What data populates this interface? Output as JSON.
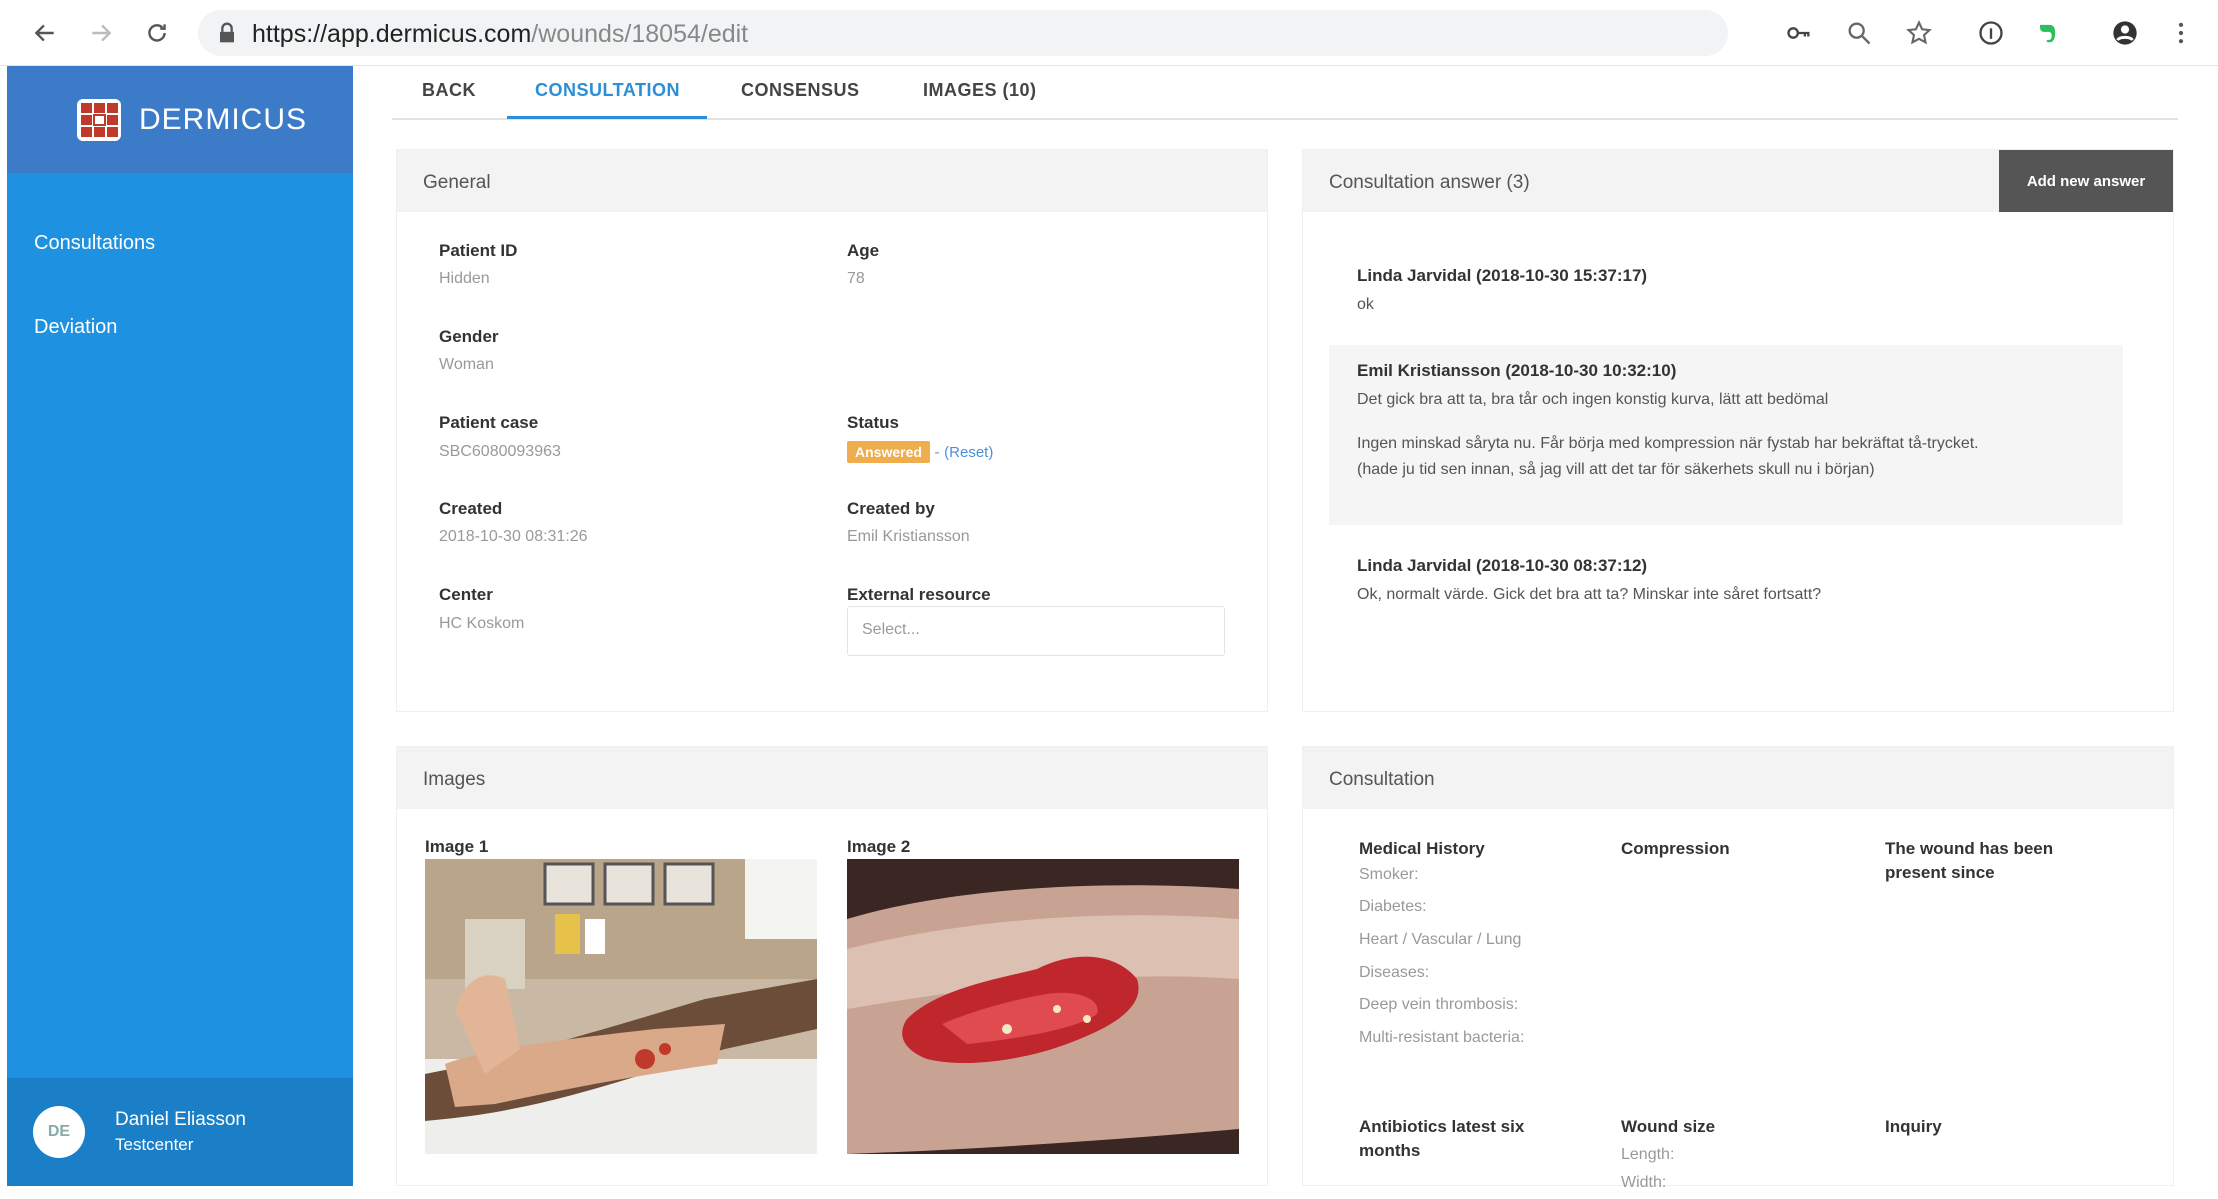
{
  "browser": {
    "url_host": "https://app.dermicus.com",
    "url_path": "/wounds/18054/edit"
  },
  "sidebar": {
    "brand": "DERMICUS",
    "items": [
      {
        "label": "Consultations"
      },
      {
        "label": "Deviation"
      }
    ],
    "user": {
      "initials": "DE",
      "name": "Daniel Eliasson",
      "role": "Testcenter"
    }
  },
  "tabs": [
    {
      "label": "BACK"
    },
    {
      "label": "CONSULTATION",
      "active": true
    },
    {
      "label": "CONSENSUS"
    },
    {
      "label": "IMAGES (10)"
    }
  ],
  "general": {
    "title": "General",
    "patient_id_label": "Patient ID",
    "patient_id": "Hidden",
    "age_label": "Age",
    "age": "78",
    "gender_label": "Gender",
    "gender": "Woman",
    "patient_case_label": "Patient case",
    "patient_case": "SBC6080093963",
    "status_label": "Status",
    "status": "Answered",
    "status_reset": "(Reset)",
    "created_label": "Created",
    "created": "2018-10-30 08:31:26",
    "created_by_label": "Created by",
    "created_by": "Emil Kristiansson",
    "center_label": "Center",
    "center": "HC Koskom",
    "external_label": "External resource",
    "external_placeholder": "Select..."
  },
  "answers": {
    "title": "Consultation answer (3)",
    "add_button": "Add new answer",
    "items": [
      {
        "author": "Linda Jarvidal (2018-10-30 15:37:17)",
        "text": "ok"
      },
      {
        "author": "Emil Kristiansson (2018-10-30 10:32:10)",
        "text": "Det gick bra att ta, bra tår och ingen konstig kurva, lätt att bedömal",
        "text2": "Ingen minskad sårytа nu. Får börja med kompression när fystab har bekräftat tå-trycket.",
        "text3": "(hade ju tid sen innan, så jag vill att det tar för säkerhets skull nu i början)"
      },
      {
        "author": "Linda Jarvidal (2018-10-30 08:37:12)",
        "text": "Ok, normalt värde. Gick det bra att ta? Minskar inte såret fortsatt?"
      }
    ]
  },
  "images": {
    "title": "Images",
    "image1_label": "Image 1",
    "image2_label": "Image 2"
  },
  "consultation": {
    "title": "Consultation",
    "medical_history_label": "Medical History",
    "medical_history": [
      "Smoker:",
      "Diabetes:",
      "Heart / Vascular / Lung",
      "Diseases:",
      "Deep vein thrombosis:",
      "Multi-resistant bacteria:"
    ],
    "compression_label": "Compression",
    "wound_present_label": "The wound has been present since",
    "antibiotics_label": "Antibiotics latest six months",
    "wound_size_label": "Wound size",
    "wound_size_items": [
      "Length:",
      "Width:"
    ],
    "inquiry_label": "Inquiry"
  }
}
